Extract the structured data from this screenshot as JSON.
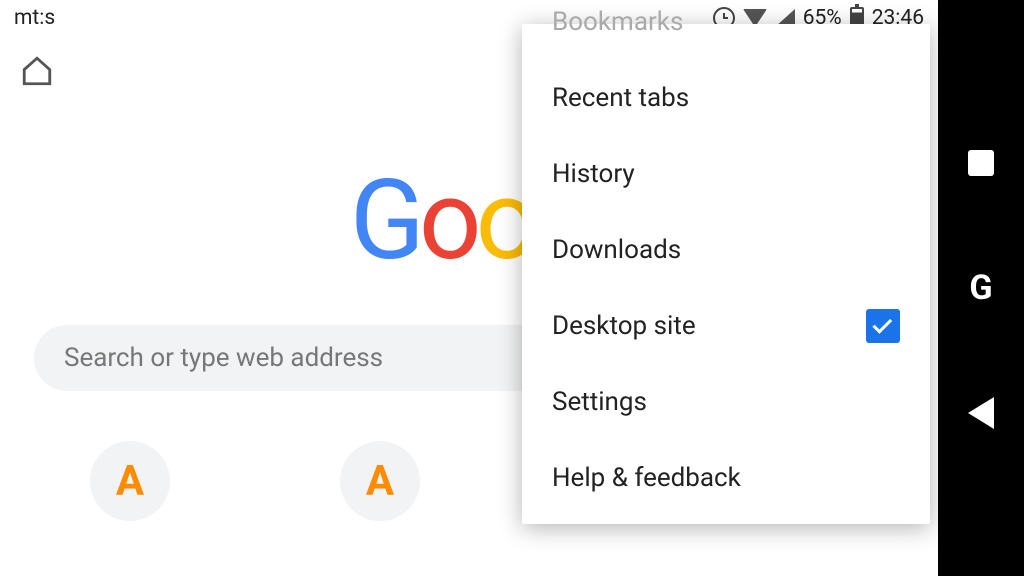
{
  "statusbar": {
    "carrier": "mt:s",
    "battery": "65%",
    "time": "23:46"
  },
  "search": {
    "placeholder": "Search or type web address"
  },
  "shortcuts": [
    "A",
    "A"
  ],
  "menu": {
    "bookmarks": "Bookmarks",
    "recent_tabs": "Recent tabs",
    "history": "History",
    "downloads": "Downloads",
    "desktop_site": "Desktop site",
    "settings": "Settings",
    "help": "Help & feedback"
  }
}
